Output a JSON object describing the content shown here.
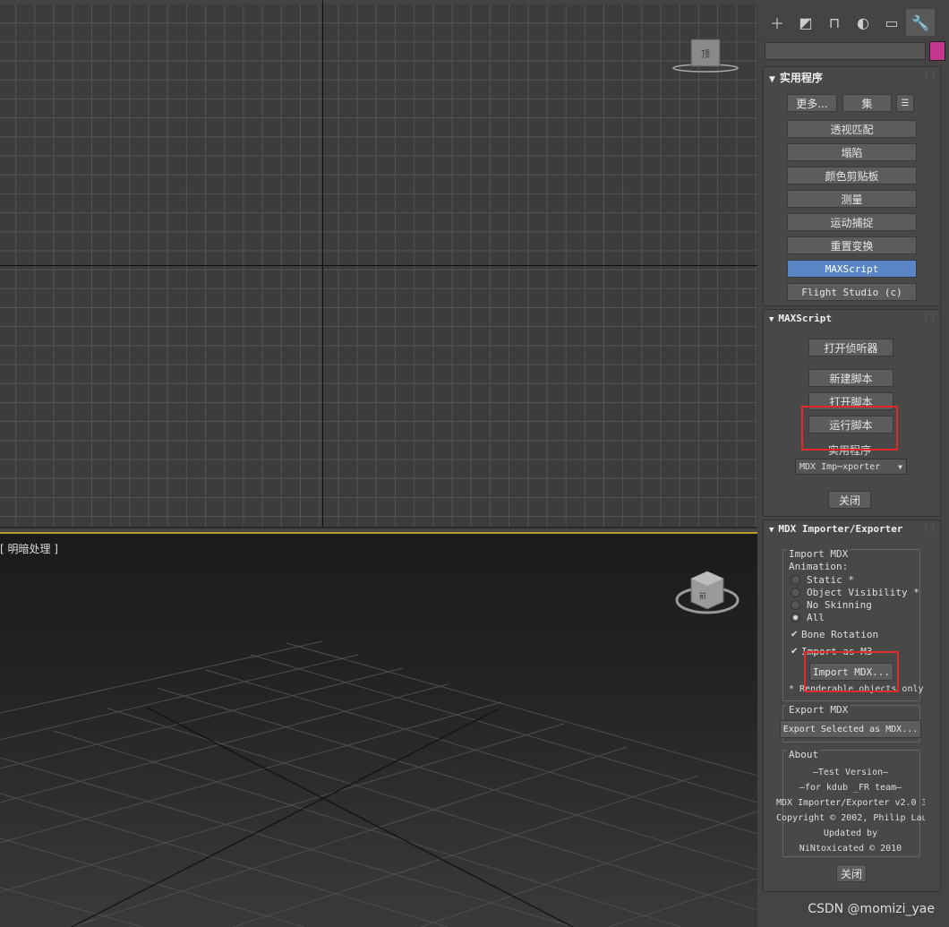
{
  "viewport_bottom": {
    "label": "[ 明暗处理 ]"
  },
  "viewcube": {
    "top_face": "顶",
    "top_label": "前"
  },
  "command_panel": {
    "tabs": [
      "create-icon",
      "modify-icon",
      "hierarchy-icon",
      "motion-icon",
      "display-icon",
      "utilities-icon"
    ],
    "colors": {
      "swatch": "#c4358c"
    }
  },
  "utilities": {
    "title": "实用程序",
    "more_label": "更多...",
    "sets_label": "集",
    "buttons": [
      "透视匹配",
      "塌陷",
      "颜色剪贴板",
      "测量",
      "运动捕捉",
      "重置变换",
      "MAXScript",
      "Flight Studio (c)"
    ]
  },
  "maxscript": {
    "title": "MAXScript",
    "open_listener": "打开侦听器",
    "new_script": "新建脚本",
    "open_script": "打开脚本",
    "run_script": "运行脚本",
    "utilities_label": "实用程序",
    "dropdown_value": "MDX Imp⋯xporter",
    "close": "关闭"
  },
  "mdx": {
    "title": "MDX Importer/Exporter",
    "import_group": "Import MDX",
    "animation_label": "Animation:",
    "anim_options": [
      "Static *",
      "Object Visibility *",
      "No Skinning",
      "All"
    ],
    "bone_rotation": "Bone Rotation",
    "import_as_m3": "Import as M3",
    "import_button": "Import MDX...",
    "renderable_note": "* Renderable objects only",
    "export_group": "Export MDX",
    "export_button": "Export Selected as MDX...",
    "about_group": "About",
    "about_lines": [
      "—Test Version—",
      "—for kdub _FR team—",
      "MDX Importer/Exporter v2.0 3",
      "Copyright © 2002, Philip Lau",
      "Updated by",
      "NiNtoxicated © 2010"
    ],
    "close": "关闭"
  },
  "watermark": "CSDN @momizi_yae"
}
